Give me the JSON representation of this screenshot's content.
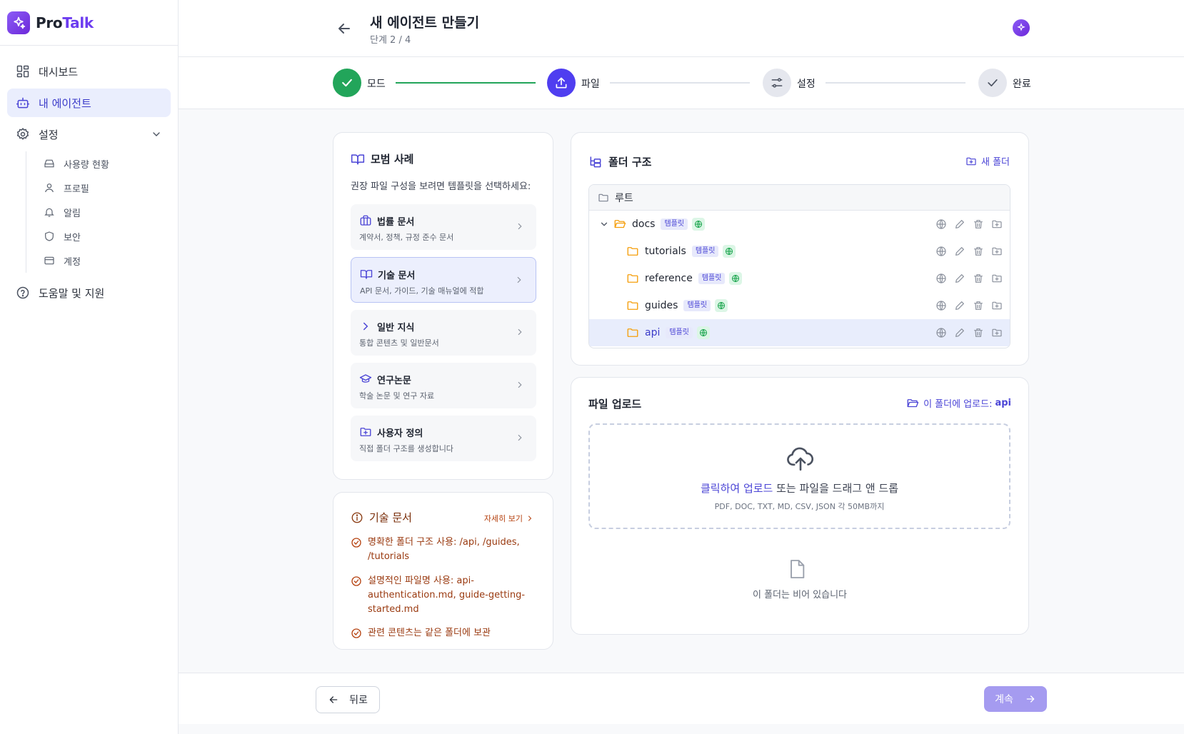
{
  "brand": {
    "name_a": "Pro",
    "name_b": "Talk"
  },
  "sidebar": {
    "items": [
      {
        "label": "대시보드",
        "icon": "dashboard-icon"
      },
      {
        "label": "내 에이전트",
        "icon": "bot-icon",
        "active": true
      },
      {
        "label": "설정",
        "icon": "gear-icon"
      }
    ],
    "sub_items": [
      {
        "label": "사용량 현황",
        "icon": "hard-drive-icon"
      },
      {
        "label": "프로필",
        "icon": "user-icon"
      },
      {
        "label": "알림",
        "icon": "bell-icon"
      },
      {
        "label": "보안",
        "icon": "shield-icon"
      },
      {
        "label": "계정",
        "icon": "credit-card-icon"
      }
    ],
    "help": {
      "label": "도움말 및 지원",
      "icon": "help-circle-icon"
    }
  },
  "header": {
    "title": "새 에이전트 만들기",
    "step": "단계 2 / 4"
  },
  "stepper": {
    "steps": [
      {
        "label": "모드",
        "state": "done"
      },
      {
        "label": "파일",
        "state": "current"
      },
      {
        "label": "설정",
        "state": "pending"
      },
      {
        "label": "완료",
        "state": "pending"
      }
    ],
    "colors": {
      "done": "#22a55a",
      "current": "#4f3ef0",
      "pending": "#e5e7ee"
    }
  },
  "templates": {
    "title": "모범 사례",
    "intro": "권장 파일 구성을 보려면 템플릿을 선택하세요:",
    "items": [
      {
        "name": "법률 문서",
        "desc": "계약서, 정책, 규정 준수 문서",
        "icon": "briefcase-icon"
      },
      {
        "name": "기술 문서",
        "desc": "API 문서, 가이드, 기술 매뉴얼에 적합",
        "icon": "book-open-icon",
        "active": true
      },
      {
        "name": "일반 지식",
        "desc": "통합 콘텐츠 및 일반문서",
        "icon": "chevron-right-icon"
      },
      {
        "name": "연구논문",
        "desc": "학술 논문 및 연구 자료",
        "icon": "graduation-cap-icon"
      },
      {
        "name": "사용자 정의",
        "desc": "직접 폴더 구조를 생성합니다",
        "icon": "folder-plus-icon"
      }
    ]
  },
  "info": {
    "title": "기술 문서",
    "more": "자세히 보기",
    "tips": [
      "명확한 폴더 구조 사용: /api, /guides, /tutorials",
      "설명적인 파일명 사용: api-authentication.md, guide-getting-started.md",
      "관련 콘텐츠는 같은 폴더에 보관"
    ]
  },
  "folders": {
    "title": "폴더 구조",
    "new_folder": "새 폴더",
    "root": "루트",
    "badge": "템플릿",
    "items": [
      {
        "name": "docs",
        "level": 0,
        "expanded": true
      },
      {
        "name": "tutorials",
        "level": 1
      },
      {
        "name": "reference",
        "level": 1
      },
      {
        "name": "guides",
        "level": 1
      },
      {
        "name": "api",
        "level": 1,
        "selected": true
      }
    ]
  },
  "upload": {
    "title": "파일 업로드",
    "target_label": "이 폴더에 업로드:",
    "target": "api",
    "click": "클릭하여 업로드",
    "or_drag": " 또는 파일을 드래그 앤 드롭",
    "formats": "PDF, DOC, TXT, MD, CSV, JSON 각 50MB까지",
    "empty": "이 폴더는 비어 있습니다"
  },
  "footer": {
    "back": "뒤로",
    "next": "계속"
  }
}
